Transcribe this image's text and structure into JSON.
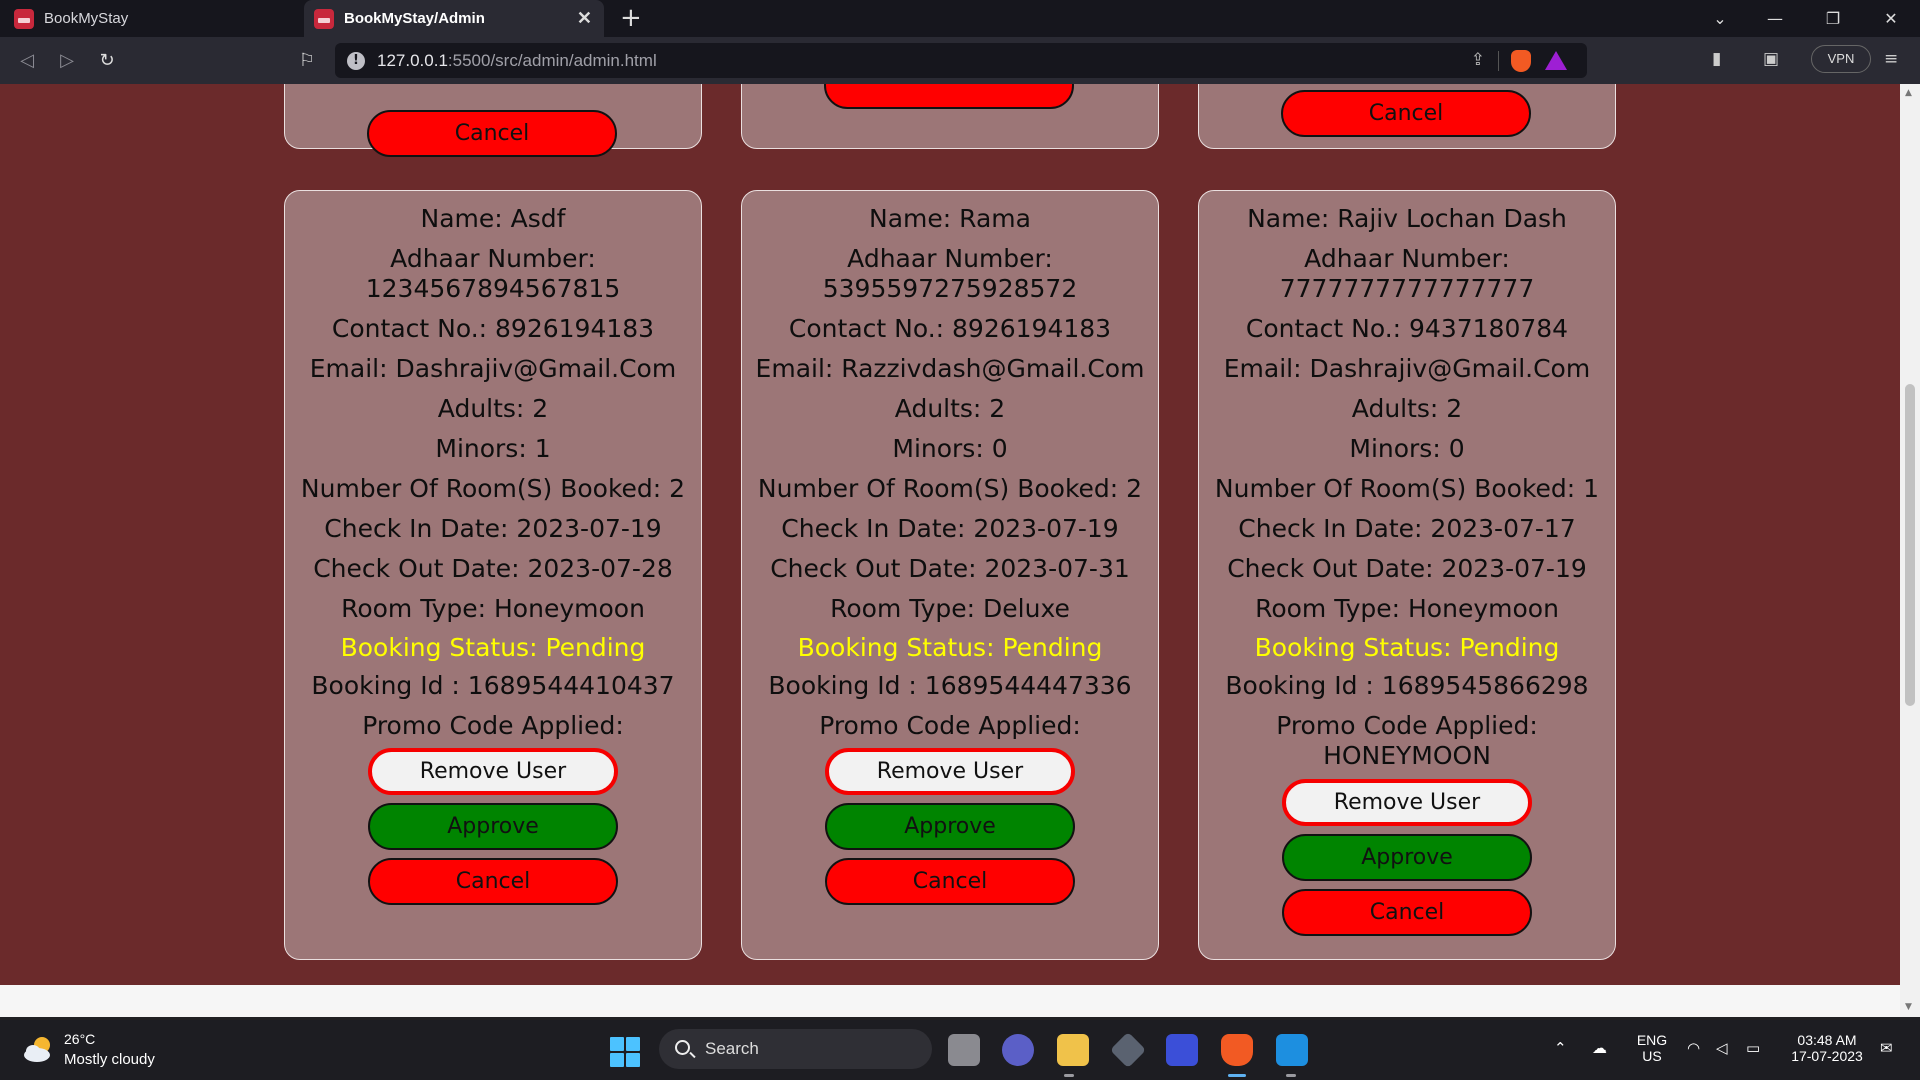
{
  "browser": {
    "tabs": [
      {
        "title": "BookMyStay",
        "active": false
      },
      {
        "title": "BookMyStay/Admin",
        "active": true
      }
    ],
    "url_host": "127.0.0.1",
    "url_rest": ":5500/src/admin/admin.html",
    "vpn_label": "VPN"
  },
  "cancel_label": "Cancel",
  "cards": [
    {
      "name": "Name: Asdf",
      "adhaar_label": "Adhaar Number:",
      "adhaar_value": "1234567894567815",
      "contact": "Contact No.: 8926194183",
      "email": "Email: Dashrajiv@Gmail.Com",
      "adults": "Adults: 2",
      "minors": "Minors: 1",
      "rooms": "Number Of Room(S) Booked: 2",
      "check_in": "Check In Date: 2023-07-19",
      "check_out": "Check Out Date: 2023-07-28",
      "room_type": "Room Type: Honeymoon",
      "status": "Booking Status: Pending",
      "booking_id": "Booking Id : 1689544410437",
      "promo_label": "Promo Code Applied:",
      "promo_value": "",
      "remove_label": "Remove User",
      "approve_label": "Approve",
      "cancel_label": "Cancel"
    },
    {
      "name": "Name: Rama",
      "adhaar_label": "Adhaar Number:",
      "adhaar_value": "5395597275928572",
      "contact": "Contact No.: 8926194183",
      "email": "Email: Razzivdash@Gmail.Com",
      "adults": "Adults: 2",
      "minors": "Minors: 0",
      "rooms": "Number Of Room(S) Booked: 2",
      "check_in": "Check In Date: 2023-07-19",
      "check_out": "Check Out Date: 2023-07-31",
      "room_type": "Room Type: Deluxe",
      "status": "Booking Status: Pending",
      "booking_id": "Booking Id : 1689544447336",
      "promo_label": "Promo Code Applied:",
      "promo_value": "",
      "remove_label": "Remove User",
      "approve_label": "Approve",
      "cancel_label": "Cancel"
    },
    {
      "name": "Name: Rajiv Lochan Dash",
      "adhaar_label": "Adhaar Number:",
      "adhaar_value": "7777777777777777",
      "contact": "Contact No.: 9437180784",
      "email": "Email: Dashrajiv@Gmail.Com",
      "adults": "Adults: 2",
      "minors": "Minors: 0",
      "rooms": "Number Of Room(S) Booked: 1",
      "check_in": "Check In Date: 2023-07-17",
      "check_out": "Check Out Date: 2023-07-19",
      "room_type": "Room Type: Honeymoon",
      "status": "Booking Status: Pending",
      "booking_id": "Booking Id : 1689545866298",
      "promo_label": "Promo Code Applied:",
      "promo_value": "HONEYMOON",
      "remove_label": "Remove User",
      "approve_label": "Approve",
      "cancel_label": "Cancel"
    }
  ],
  "taskbar": {
    "temperature": "26°C",
    "weather": "Mostly cloudy",
    "search_label": "Search",
    "lang_top": "ENG",
    "lang_bottom": "US",
    "time": "03:48 AM",
    "date": "17-07-2023"
  },
  "colors": {
    "page_background": "#6b2a2b",
    "card_background": "#9c7677",
    "status_text": "#ffff00",
    "approve": "#008400",
    "cancel": "#ff0000"
  }
}
